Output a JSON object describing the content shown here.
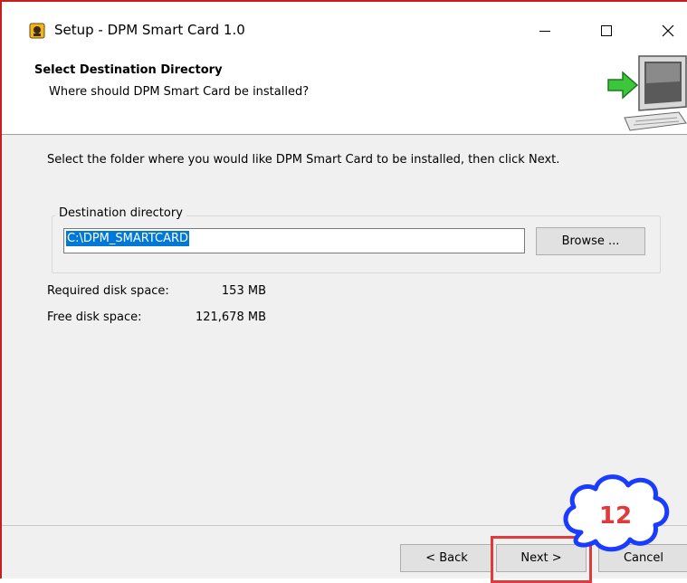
{
  "window": {
    "title": "Setup - DPM Smart Card 1.0",
    "icons": {
      "app": "app-icon",
      "minimize": "minimize-icon",
      "maximize": "maximize-icon",
      "close": "close-icon"
    }
  },
  "header": {
    "title": "Select Destination Directory",
    "subtitle": "Where should DPM Smart Card be installed?",
    "image": "computer-install-icon"
  },
  "main": {
    "instruction": "Select the folder where you would like DPM Smart Card to be installed, then click Next.",
    "group_label": "Destination directory",
    "directory_value": "C:\\DPM_SMARTCARD",
    "browse_label": "Browse ...",
    "required_label": "Required disk space:",
    "required_value": "153 MB",
    "free_label": "Free disk space:",
    "free_value": "121,678 MB"
  },
  "footer": {
    "back_label": "< Back",
    "next_label": "Next >",
    "cancel_label": "Cancel"
  },
  "annotation": {
    "step_number": "12",
    "highlight_color": "#e03a3a",
    "badge_color": "#1a3cff"
  },
  "colors": {
    "selection": "#0078d7",
    "window_border": "#c91e1e"
  }
}
